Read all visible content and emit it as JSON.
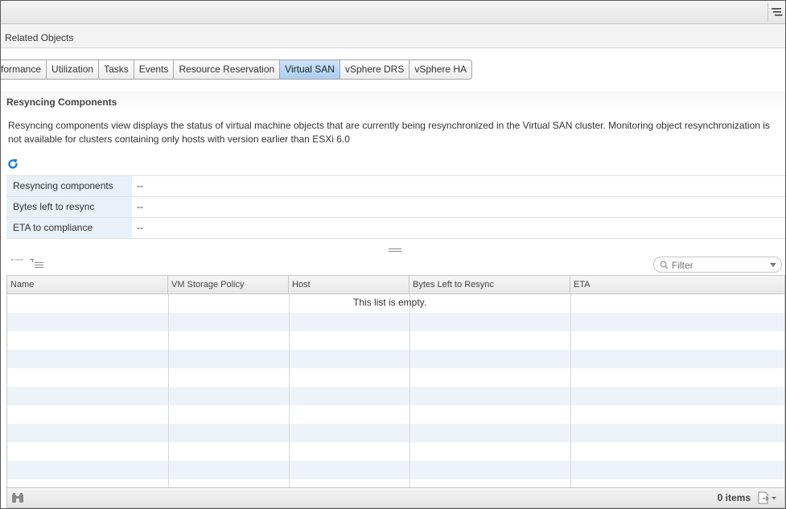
{
  "header": {
    "related_objects_label": "Related Objects"
  },
  "tabs": [
    {
      "label": "formance",
      "active": false
    },
    {
      "label": "Utilization",
      "active": false
    },
    {
      "label": "Tasks",
      "active": false
    },
    {
      "label": "Events",
      "active": false
    },
    {
      "label": "Resource Reservation",
      "active": false
    },
    {
      "label": "Virtual SAN",
      "active": true
    },
    {
      "label": "vSphere DRS",
      "active": false
    },
    {
      "label": "vSphere HA",
      "active": false
    }
  ],
  "section": {
    "title": "Resyncing Components",
    "description": "Resyncing components view displays the status of virtual machine objects that are currently being resynchronized in the Virtual SAN cluster. Monitoring object resynchronization is not available for clusters containing only hosts with version earlier than ESXi 6.0"
  },
  "properties": [
    {
      "label": "Resyncing components",
      "value": "--"
    },
    {
      "label": "Bytes left to resync",
      "value": "--"
    },
    {
      "label": "ETA to compliance",
      "value": "--"
    }
  ],
  "filter": {
    "placeholder": "Filter"
  },
  "grid": {
    "columns": [
      "Name",
      "VM Storage Policy",
      "Host",
      "Bytes Left to Resync",
      "ETA"
    ],
    "empty_message": "This list is empty.",
    "item_count": "0 items"
  },
  "colors": {
    "active_tab": "#a9cdf2",
    "property_key_bg": "#e8f0f8",
    "row_stripe": "#eef3f9",
    "refresh_icon": "#1a7fd4"
  },
  "icons": {
    "menu": "menu-lines-icon",
    "refresh": "refresh-icon",
    "splitter": "splitter-grip-icon",
    "expand": "expand-rows-icon",
    "collapse": "collapse-rows-icon",
    "search": "search-icon",
    "binoculars": "binoculars-icon",
    "export": "export-icon"
  }
}
